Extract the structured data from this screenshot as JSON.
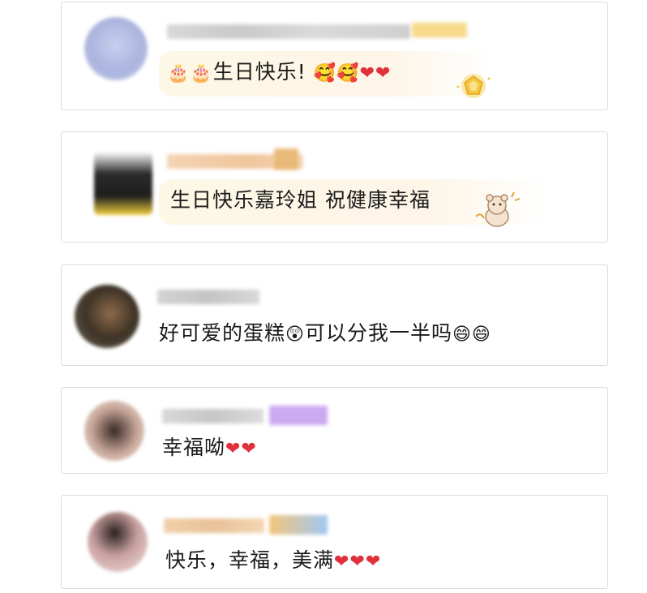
{
  "comments": [
    {
      "text": "生日快乐!",
      "prefix_emojis": "🎂🎂",
      "suffix_emojis": "🥰🥰",
      "hearts": "❤❤"
    },
    {
      "text": "生日快乐嘉玲姐 祝健康幸福"
    },
    {
      "text": "好可爱的蛋糕",
      "mid_emoji": "😲",
      "text2": "可以分我一半吗",
      "suffix_emojis": "😄😄"
    },
    {
      "text": "幸福呦",
      "hearts": "❤❤"
    },
    {
      "text": "快乐，幸福，美满",
      "hearts": "❤❤❤"
    }
  ],
  "colors": {
    "card_border": "#dcdcdc",
    "heart": "#e0313a",
    "bubble": "#fdf7e6",
    "text": "#1a1a1a"
  },
  "icons": [
    "avatar-blurred",
    "username-blurred",
    "gem-badge-icon",
    "bear-sticker-icon"
  ]
}
